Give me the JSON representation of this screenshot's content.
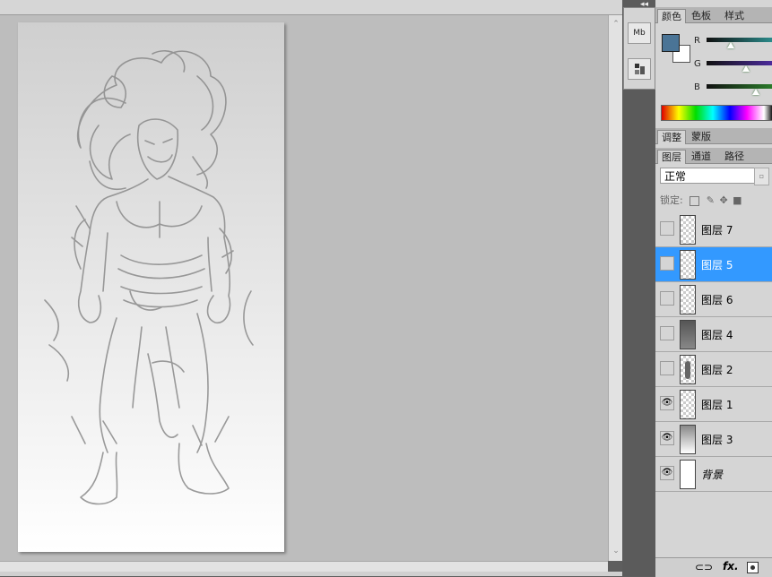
{
  "panel_collapse_glyph": "◂◂",
  "document": {
    "icon": "sketch-artwork",
    "description_free": true
  },
  "mini_toolbar": [
    {
      "label": "Mb",
      "icon": "mini-bridge-icon"
    },
    {
      "label": "",
      "icon": "layer-comps-icon"
    }
  ],
  "color_panel": {
    "tabs": [
      "颜色",
      "色板",
      "样式"
    ],
    "active_tab": 0,
    "foreground": "#4a7496",
    "background": "#ffffff",
    "channels": [
      {
        "label": "R",
        "value_fraction": 0.37,
        "color": "#2a8a8a"
      },
      {
        "label": "G",
        "value_fraction": 0.6,
        "color": "#4a2a9a"
      },
      {
        "label": "B",
        "value_fraction": 0.75,
        "color": "#2a7a2a"
      }
    ]
  },
  "adjust_panel": {
    "tabs": [
      "调整",
      "蒙版"
    ],
    "active_tab": 0
  },
  "layers_panel": {
    "tabs": [
      "图层",
      "通道",
      "路径"
    ],
    "active_tab": 0,
    "blend_mode": "正常",
    "lock_label": "锁定:",
    "layers": [
      {
        "name": "图层 7",
        "visible": false,
        "selected": false,
        "thumb": "transparent"
      },
      {
        "name": "图层 5",
        "visible": false,
        "selected": true,
        "thumb": "transparent"
      },
      {
        "name": "图层 6",
        "visible": false,
        "selected": false,
        "thumb": "transparent"
      },
      {
        "name": "图层 4",
        "visible": false,
        "selected": false,
        "thumb": "dark"
      },
      {
        "name": "图层 2",
        "visible": false,
        "selected": false,
        "thumb": "figure"
      },
      {
        "name": "图层 1",
        "visible": true,
        "selected": false,
        "thumb": "transparent"
      },
      {
        "name": "图层 3",
        "visible": true,
        "selected": false,
        "thumb": "gradient"
      },
      {
        "name": "背景",
        "visible": true,
        "selected": false,
        "thumb": "white",
        "italic": true
      }
    ],
    "bottom_icons": [
      "link-icon",
      "fx-icon",
      "mask-icon"
    ],
    "fx_label": "fx."
  }
}
